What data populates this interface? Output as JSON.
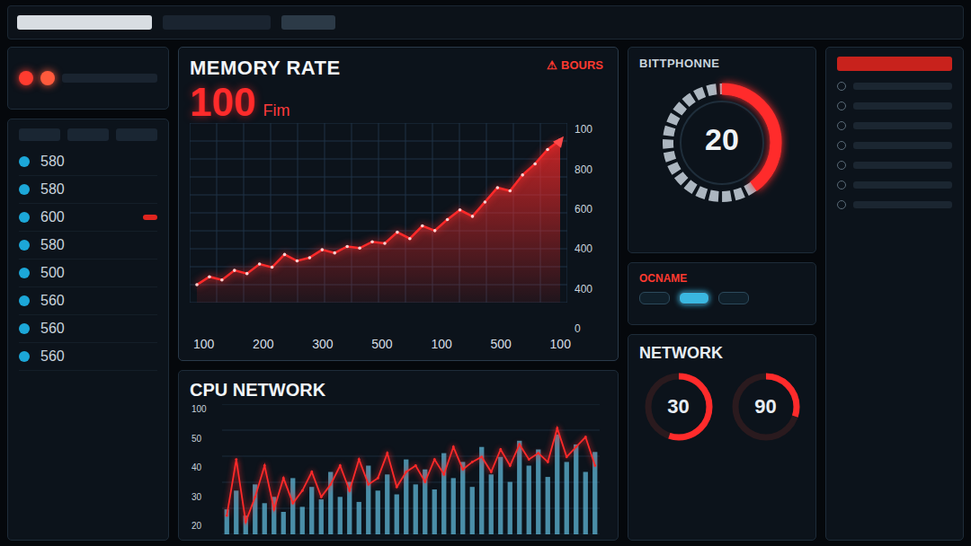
{
  "left_leds": [
    {
      "on": true,
      "color": "#ff3b2f"
    },
    {
      "on": true,
      "color": "#ff5a3c"
    }
  ],
  "left_table": {
    "rows": [
      {
        "value": "580",
        "color": "#1ca7d8",
        "alert": false
      },
      {
        "value": "580",
        "color": "#1ca7d8",
        "alert": false
      },
      {
        "value": "600",
        "color": "#1ca7d8",
        "alert": true
      },
      {
        "value": "580",
        "color": "#1ca7d8",
        "alert": false
      },
      {
        "value": "500",
        "color": "#1ca7d8",
        "alert": false
      },
      {
        "value": "560",
        "color": "#1ca7d8",
        "alert": false
      },
      {
        "value": "560",
        "color": "#1ca7d8",
        "alert": false
      },
      {
        "value": "560",
        "color": "#1ca7d8",
        "alert": false
      }
    ]
  },
  "memory_chart": {
    "title": "MEMORY RATE",
    "value": "100",
    "unit": "Fim",
    "alert": {
      "icon": "⚠",
      "label": "BOURS"
    },
    "y_ticks": [
      "100",
      "800",
      "600",
      "400",
      "400",
      "0"
    ],
    "x_ticks": [
      "100",
      "200",
      "300",
      "500",
      "100",
      "500",
      "100"
    ],
    "series": [
      {
        "name": "memory",
        "color": "#ff2a2a",
        "values": [
          90,
          140,
          120,
          180,
          160,
          220,
          200,
          280,
          240,
          260,
          310,
          290,
          330,
          320,
          360,
          350,
          420,
          380,
          460,
          430,
          500,
          560,
          520,
          610,
          700,
          680,
          780,
          850,
          940,
          1000
        ]
      }
    ]
  },
  "cpu_chart": {
    "title": "CPU NETWORK",
    "y_ticks": [
      "100",
      "50",
      "40",
      "30",
      "20"
    ],
    "series": [
      {
        "name": "bars",
        "color": "#5fb8d8",
        "values": [
          20,
          35,
          15,
          40,
          25,
          30,
          18,
          45,
          22,
          38,
          28,
          50,
          30,
          42,
          26,
          55,
          35,
          48,
          32,
          60,
          40,
          52,
          36,
          65,
          45,
          58,
          38,
          70,
          48,
          62,
          42,
          75,
          55,
          68,
          46,
          80,
          58,
          72,
          50,
          66
        ]
      },
      {
        "name": "line",
        "color": "#ff2a2a",
        "values": [
          15,
          60,
          10,
          30,
          55,
          20,
          45,
          25,
          35,
          50,
          30,
          40,
          55,
          35,
          60,
          40,
          45,
          65,
          38,
          50,
          55,
          42,
          60,
          48,
          70,
          52,
          58,
          62,
          50,
          68,
          55,
          72,
          60,
          65,
          58,
          85,
          62,
          70,
          78,
          55
        ]
      }
    ]
  },
  "gauge": {
    "title": "BITTPHONNE",
    "value": "20",
    "level": 0.4
  },
  "status_panel": {
    "title": "OCNAME",
    "toggles": [
      {
        "on": false
      },
      {
        "on": true
      },
      {
        "on": false
      }
    ]
  },
  "network": {
    "title": "NETWORK",
    "gauges": [
      {
        "value": "30",
        "level": 0.55
      },
      {
        "value": "90",
        "level": 0.3
      }
    ]
  },
  "side_list": {
    "items": [
      {
        "selected": true
      },
      {
        "selected": false
      },
      {
        "selected": false
      },
      {
        "selected": false
      },
      {
        "selected": false
      },
      {
        "selected": false
      },
      {
        "selected": false
      },
      {
        "selected": false
      }
    ]
  }
}
